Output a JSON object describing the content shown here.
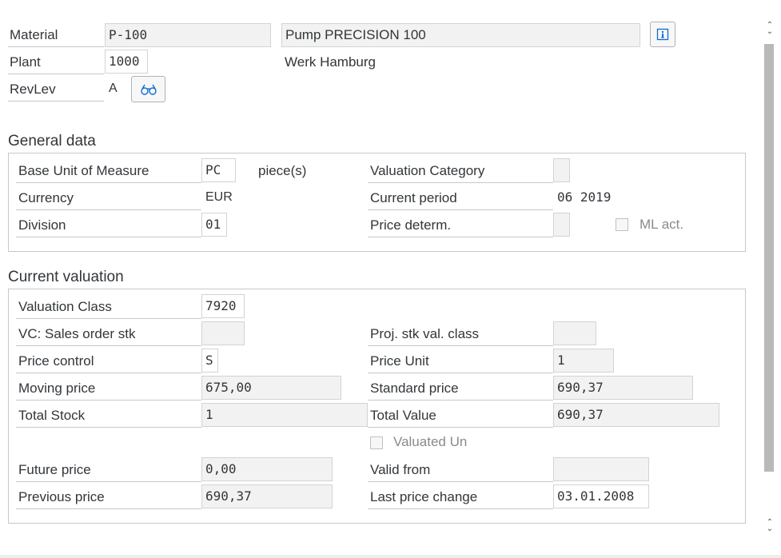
{
  "header": {
    "material_label": "Material",
    "material_value": "P-100",
    "material_desc": "Pump PRECISION 100",
    "plant_label": "Plant",
    "plant_value": "1000",
    "plant_desc": "Werk Hamburg",
    "revlev_label": "RevLev",
    "revlev_value": "A"
  },
  "general": {
    "title": "General data",
    "base_uom_label": "Base Unit of Measure",
    "base_uom_value": "PC",
    "base_uom_text": "piece(s)",
    "currency_label": "Currency",
    "currency_value": "EUR",
    "division_label": "Division",
    "division_value": "01",
    "valuation_category_label": "Valuation Category",
    "valuation_category_value": "",
    "current_period_label": "Current period",
    "current_period_value": "06 2019",
    "price_determ_label": "Price determ.",
    "price_determ_value": "",
    "ml_act_label": "ML act."
  },
  "valuation": {
    "title": "Current valuation",
    "valuation_class_label": "Valuation Class",
    "valuation_class_value": "7920",
    "vc_sales_label": "VC: Sales order stk",
    "vc_sales_value": "",
    "proj_stk_label": "Proj. stk val. class",
    "proj_stk_value": "",
    "price_control_label": "Price control",
    "price_control_value": "S",
    "price_unit_label": "Price Unit",
    "price_unit_value": "1",
    "moving_price_label": "Moving price",
    "moving_price_value": "675,00",
    "standard_price_label": "Standard price",
    "standard_price_value": "690,37",
    "total_stock_label": "Total Stock",
    "total_stock_value": "1",
    "total_value_label": "Total Value",
    "total_value_value": "690,37",
    "valuated_un_label": "Valuated Un",
    "future_price_label": "Future price",
    "future_price_value": "0,00",
    "valid_from_label": "Valid from",
    "valid_from_value": "",
    "previous_price_label": "Previous price",
    "previous_price_value": "690,37",
    "last_price_change_label": "Last price change",
    "last_price_change_value": "03.01.2008"
  },
  "icons": {
    "info": "info-icon",
    "display": "glasses-icon",
    "scroll_up": "scroll-up-icon",
    "scroll_down": "scroll-down-icon"
  },
  "colors": {
    "accent": "#0a6ed1",
    "field_bg": "#f2f2f2",
    "border": "#c8c8c8"
  }
}
